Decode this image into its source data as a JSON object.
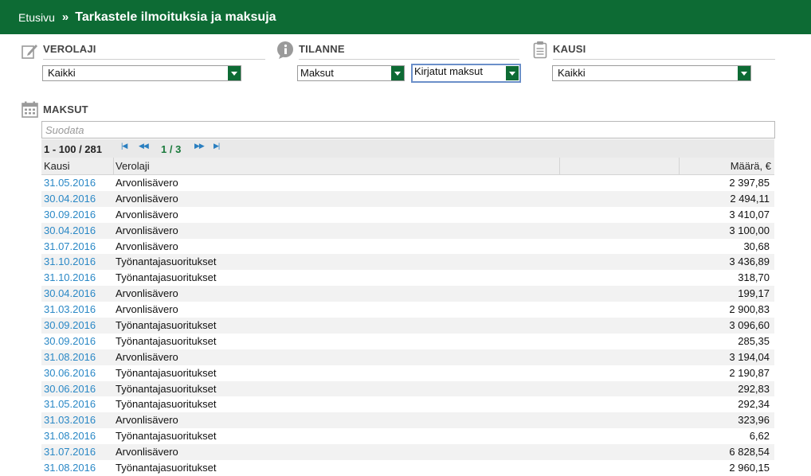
{
  "header": {
    "home": "Etusivu",
    "separator": "»",
    "title": "Tarkastele ilmoituksia ja maksuja"
  },
  "filters": {
    "verolaji": {
      "label": "VEROLAJI",
      "value": "Kaikki"
    },
    "tilanne": {
      "label": "TILANNE",
      "value1": "Maksut",
      "value2": "Kirjatut maksut"
    },
    "kausi": {
      "label": "KAUSI",
      "value": "Kaikki"
    }
  },
  "maksut": {
    "label": "MAKSUT",
    "filter_placeholder": "Suodata",
    "range": "1 - 100 / 281",
    "page": "1 / 3",
    "pager_icons": {
      "first": "first-page-icon",
      "prev": "previous-page-icon",
      "next": "next-page-icon",
      "last": "last-page-icon"
    },
    "columns": [
      "Kausi",
      "Verolaji",
      "",
      "Määrä, €"
    ],
    "rows": [
      [
        "31.05.2016",
        "Arvonlisävero",
        "2 397,85"
      ],
      [
        "30.04.2016",
        "Arvonlisävero",
        "2 494,11"
      ],
      [
        "30.09.2016",
        "Arvonlisävero",
        "3 410,07"
      ],
      [
        "30.04.2016",
        "Arvonlisävero",
        "3 100,00"
      ],
      [
        "31.07.2016",
        "Arvonlisävero",
        "30,68"
      ],
      [
        "31.10.2016",
        "Työnantajasuoritukset",
        "3 436,89"
      ],
      [
        "31.10.2016",
        "Työnantajasuoritukset",
        "318,70"
      ],
      [
        "30.04.2016",
        "Arvonlisävero",
        "199,17"
      ],
      [
        "31.03.2016",
        "Arvonlisävero",
        "2 900,83"
      ],
      [
        "30.09.2016",
        "Työnantajasuoritukset",
        "3 096,60"
      ],
      [
        "30.09.2016",
        "Työnantajasuoritukset",
        "285,35"
      ],
      [
        "31.08.2016",
        "Arvonlisävero",
        "3 194,04"
      ],
      [
        "30.06.2016",
        "Työnantajasuoritukset",
        "2 190,87"
      ],
      [
        "30.06.2016",
        "Työnantajasuoritukset",
        "292,83"
      ],
      [
        "31.05.2016",
        "Työnantajasuoritukset",
        "292,34"
      ],
      [
        "31.03.2016",
        "Arvonlisävero",
        "323,96"
      ],
      [
        "31.08.2016",
        "Työnantajasuoritukset",
        "6,62"
      ],
      [
        "31.07.2016",
        "Arvonlisävero",
        "6 828,54"
      ],
      [
        "31.08.2016",
        "Työnantajasuoritukset",
        "2 960,15"
      ]
    ]
  },
  "colors": {
    "brand_green": "#0d6b34",
    "link_blue": "#2a88c6",
    "page_green": "#1a7a3c"
  }
}
